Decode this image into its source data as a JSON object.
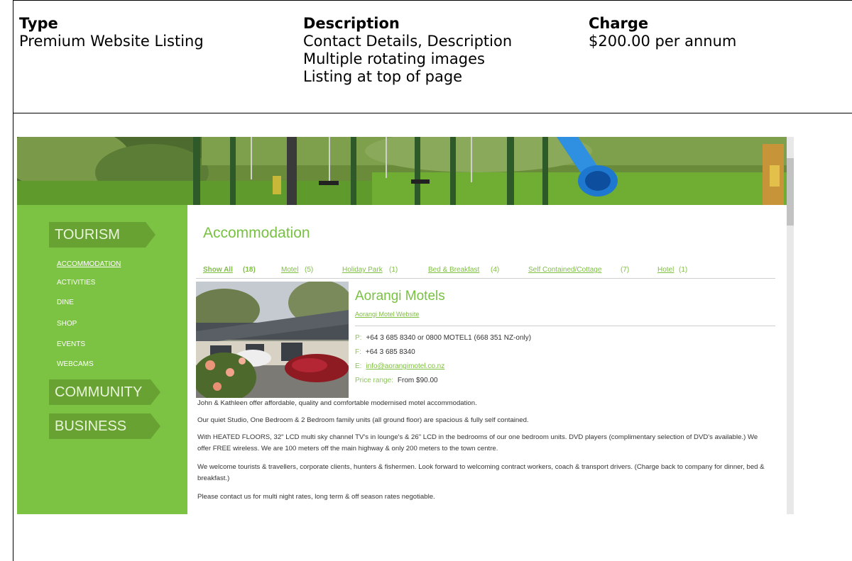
{
  "table": {
    "headers": [
      "Type",
      "Description",
      "Charge"
    ],
    "type": "Premium Website Listing",
    "description_lines": [
      "Contact Details, Description",
      "Multiple rotating images",
      "Listing at top of page"
    ],
    "charge": "$200.00 per annum"
  },
  "screenshot": {
    "nav": {
      "main": [
        "TOURISM",
        "COMMUNITY",
        "BUSINESS"
      ],
      "sub": [
        "ACCOMMODATION",
        "ACTIVITIES",
        "DINE",
        "SHOP",
        "EVENTS",
        "WEBCAMS"
      ],
      "active_sub": "ACCOMMODATION"
    },
    "section_title": "Accommodation",
    "filters": [
      {
        "label": "Show All",
        "count": "(18)"
      },
      {
        "label": "Motel",
        "count": "(5)"
      },
      {
        "label": "Holiday Park",
        "count": "(1)"
      },
      {
        "label": "Bed & Breakfast",
        "count": "(4)"
      },
      {
        "label": "Self Contained/Cottage",
        "count": "(7)"
      },
      {
        "label": "Hotel",
        "count": "(1)"
      }
    ],
    "listing": {
      "name": "Aorangi Motels",
      "website_link": "Aorangi Motel Website",
      "phone_label": "P:",
      "phone": "+64 3 685 8340 or 0800 MOTEL1 (668 351 NZ-only)",
      "fax_label": "F:",
      "fax": "+64 3 685 8340",
      "email_label": "E:",
      "email": "info@aorangimotel.co.nz",
      "price_label": "Price range:",
      "price": "From $90.00",
      "paragraphs": [
        "John & Kathleen offer affordable, quality and comfortable modernised motel accommodation.",
        "Our quiet Studio, One Bedroom & 2 Bedroom family units (all ground floor) are spacious & fully self contained.",
        "With HEATED FLOORS, 32\" LCD multi sky channel TV's in lounge's & 26\" LCD in the bedrooms of our one bedroom units. DVD players (complimentary selection of DVD's available.) We offer FREE wireless. We are 100 meters off the main highway & only 200 meters to the town centre.",
        "We welcome tourists & travellers, corporate clients, hunters & fishermen. Look forward to welcoming contract workers, coach & transport drivers. (Charge back to company for dinner, bed & breakfast.)",
        "Please contact us for multi night rates, long term & off season rates negotiable."
      ]
    }
  }
}
